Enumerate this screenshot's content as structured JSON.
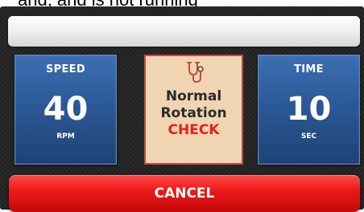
{
  "caption": "and, and is not running",
  "speed": {
    "label": "SPEED",
    "value": "40",
    "unit": "RPM"
  },
  "status": {
    "line1": "Normal",
    "line2": "Rotation",
    "check": "CHECK",
    "icon": "stethoscope-icon"
  },
  "time": {
    "label": "TIME",
    "value": "10",
    "unit": "SEC"
  },
  "cancel": {
    "label": "CANCEL"
  },
  "colors": {
    "tile_blue": "#2c5996",
    "status_bg": "#efd5b2",
    "status_border": "#c84a3c",
    "check_red": "#ee1c1c",
    "cancel_red": "#ee1a1a",
    "panel_bg": "#262626"
  }
}
